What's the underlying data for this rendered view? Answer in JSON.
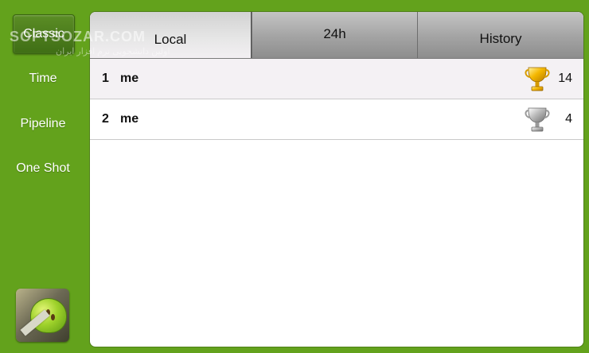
{
  "sidebar": {
    "modes": [
      {
        "label": "Classic",
        "active": true
      },
      {
        "label": "Time",
        "active": false
      },
      {
        "label": "Pipeline",
        "active": false
      },
      {
        "label": "One Shot",
        "active": false
      }
    ],
    "app_icon": "apple-slice-icon"
  },
  "watermark": {
    "text": "SOFTSOZAR.COM",
    "subtext": "اولین دانشجویی نرم افزار ایران"
  },
  "tabs": [
    {
      "label": "Local",
      "active": true
    },
    {
      "label": "24h",
      "active": false
    },
    {
      "label": "History",
      "active": false
    }
  ],
  "scores": [
    {
      "rank": "1",
      "name": "me",
      "trophy": "gold-trophy-icon",
      "trophy_color": "#f2b400",
      "score": "14"
    },
    {
      "rank": "2",
      "name": "me",
      "trophy": "silver-trophy-icon",
      "trophy_color": "#a9a9a9",
      "score": "4"
    }
  ],
  "colors": {
    "background": "#63a21c",
    "panel": "#ffffff",
    "active_mode": "#4a7c1c"
  }
}
